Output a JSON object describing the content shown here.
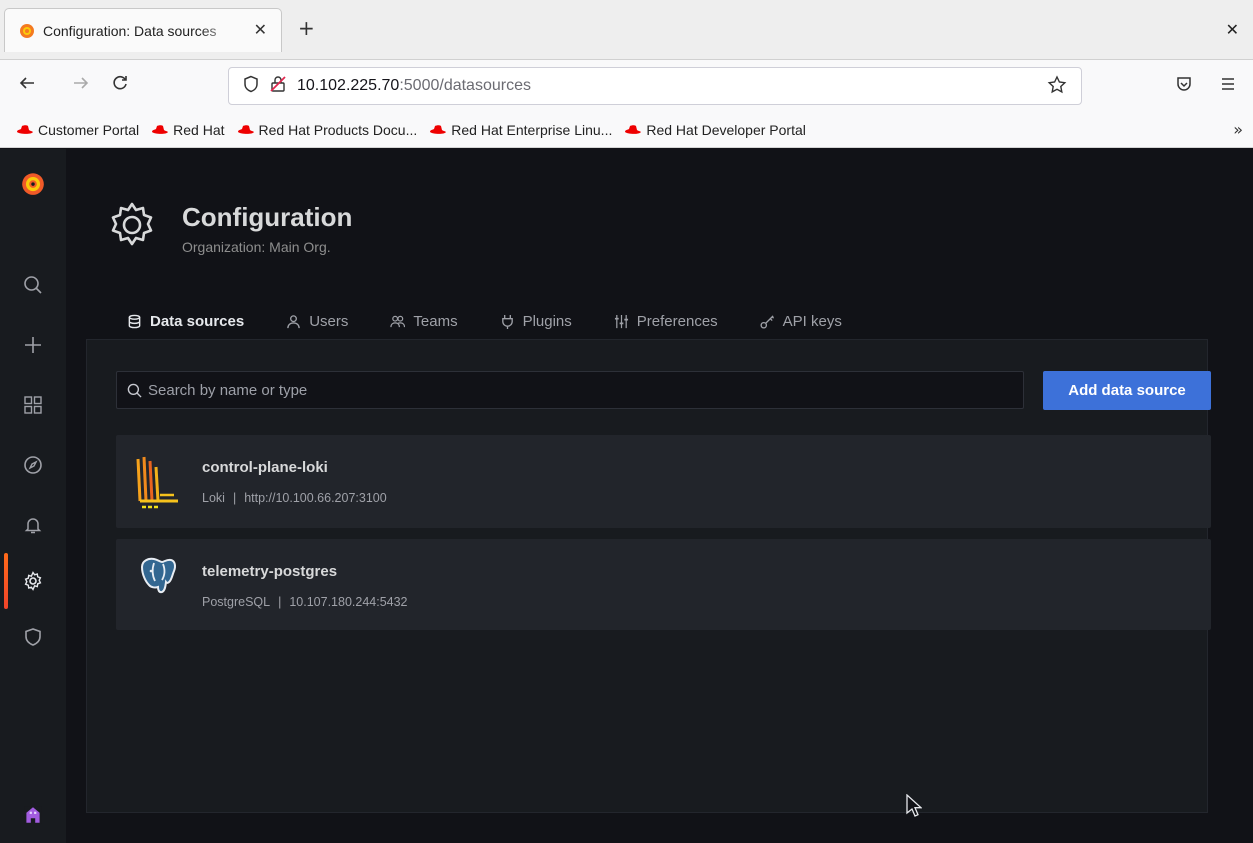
{
  "browser": {
    "tab_title": "Configuration: Data sources",
    "tab_close": "✕",
    "new_tab": "+",
    "window_close": "✕",
    "url_host": "10.102.225.70",
    "url_rest": ":5000/datasources",
    "bookmarks": [
      "Customer Portal",
      "Red Hat",
      "Red Hat Products Docu...",
      "Red Hat Enterprise Linu...",
      "Red Hat Developer Portal"
    ],
    "bookmarks_more": "»"
  },
  "grafana": {
    "sidebar_icons": [
      "grafana-logo-icon",
      "search-icon",
      "plus-icon",
      "dashboards-icon",
      "explore-compass-icon",
      "alerting-bell-icon",
      "configuration-gear-icon",
      "server-admin-shield-icon",
      "user-avatar-icon"
    ],
    "active_sidebar_item": "configuration",
    "page": {
      "title": "Configuration",
      "subtitle": "Organization: Main Org."
    },
    "tabs": [
      {
        "label": "Data sources",
        "icon": "database-icon",
        "active": true
      },
      {
        "label": "Users",
        "icon": "user-icon",
        "active": false
      },
      {
        "label": "Teams",
        "icon": "users-icon",
        "active": false
      },
      {
        "label": "Plugins",
        "icon": "plug-icon",
        "active": false
      },
      {
        "label": "Preferences",
        "icon": "sliders-icon",
        "active": false
      },
      {
        "label": "API keys",
        "icon": "key-icon",
        "active": false
      }
    ],
    "search": {
      "placeholder": "Search by name or type",
      "value": ""
    },
    "add_button": "Add data source",
    "datasources": [
      {
        "name": "control-plane-loki",
        "type": "Loki",
        "url": "http://10.100.66.207:3100",
        "logo": "loki-logo-icon"
      },
      {
        "name": "telemetry-postgres",
        "type": "PostgreSQL",
        "url": "10.107.180.244:5432",
        "logo": "postgresql-logo-icon"
      }
    ],
    "meta_separator": "|"
  },
  "colors": {
    "accent_orange": "#ff6b1a",
    "primary_blue": "#3d71d9",
    "sidebar_bg": "#181b1f",
    "page_bg": "#111217",
    "card_bg": "#22252b"
  }
}
